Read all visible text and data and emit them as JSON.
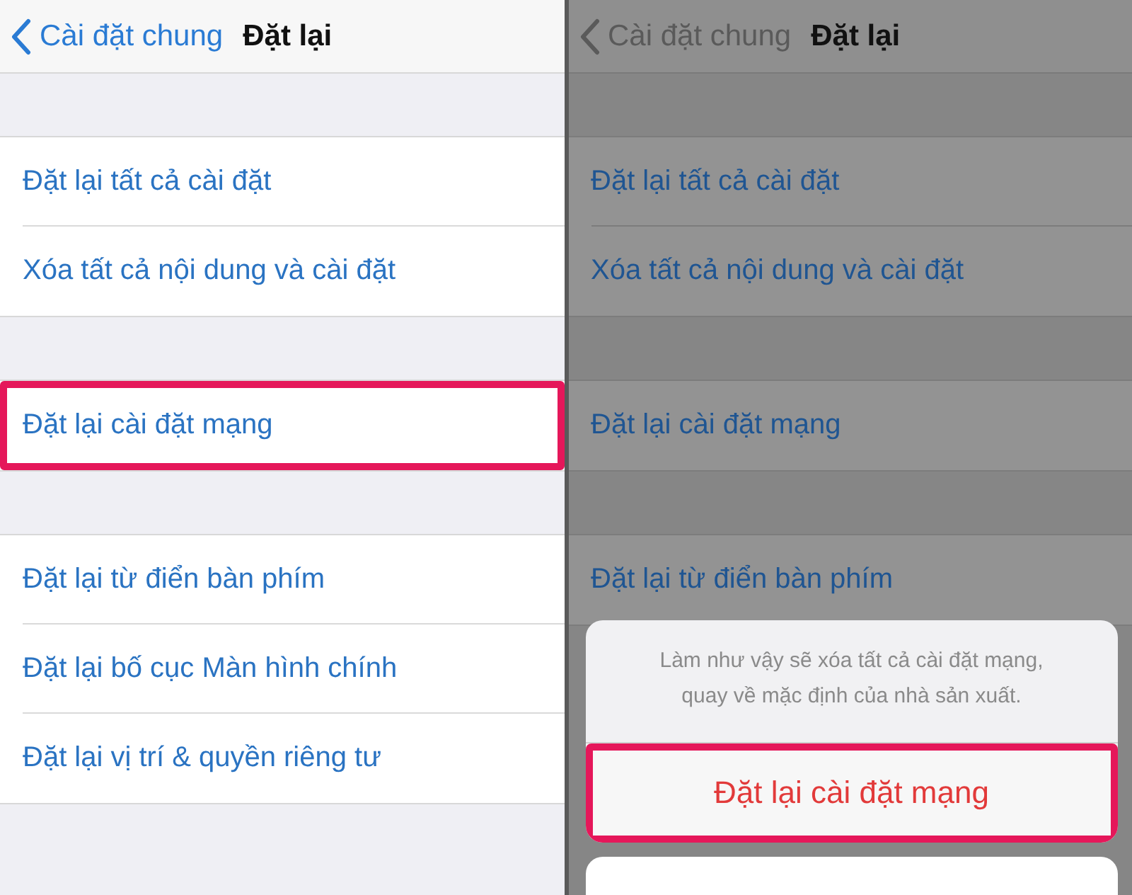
{
  "panels": [
    {
      "dimmed": false,
      "nav": {
        "back": "Cài đặt chung",
        "title": "Đặt lại"
      },
      "groups": [
        [
          {
            "label": "Đặt lại tất cả cài đặt",
            "highlighted": false
          },
          {
            "label": "Xóa tất cả nội dung và cài đặt",
            "highlighted": false
          }
        ],
        [
          {
            "label": "Đặt lại cài đặt mạng",
            "highlighted": true
          }
        ],
        [
          {
            "label": "Đặt lại từ điển bàn phím",
            "highlighted": false
          },
          {
            "label": "Đặt lại bố cục Màn hình chính",
            "highlighted": false
          },
          {
            "label": "Đặt lại vị trí & quyền riêng tư",
            "highlighted": false
          }
        ]
      ]
    },
    {
      "dimmed": true,
      "nav": {
        "back": "Cài đặt chung",
        "title": "Đặt lại"
      },
      "groups": [
        [
          {
            "label": "Đặt lại tất cả cài đặt",
            "highlighted": false
          },
          {
            "label": "Xóa tất cả nội dung và cài đặt",
            "highlighted": false
          }
        ],
        [
          {
            "label": "Đặt lại cài đặt mạng",
            "highlighted": false
          }
        ],
        [
          {
            "label": "Đặt lại từ điển bàn phím",
            "highlighted": false
          }
        ]
      ],
      "sheet": {
        "message": "Làm như vậy sẽ xóa tất cả cài đặt mạng,\nquay về mặc định của nhà sản xuất.",
        "action": {
          "label": "Đặt lại cài đặt mạng",
          "highlighted": true
        }
      }
    }
  ]
}
